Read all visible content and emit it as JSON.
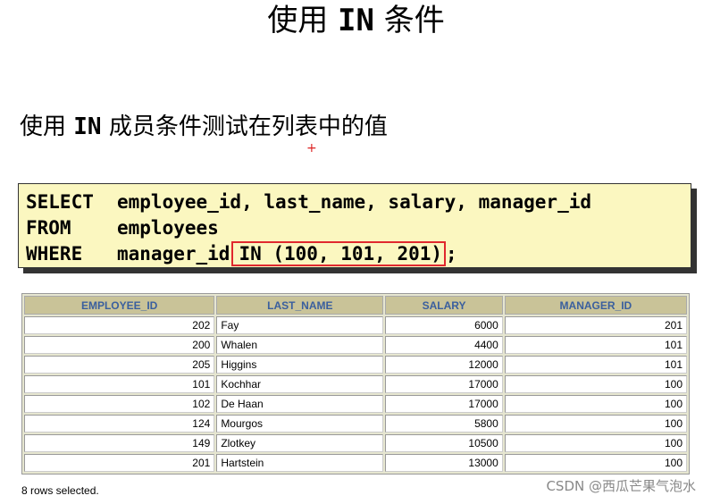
{
  "title": {
    "prefix": "使用",
    "keyword": "IN",
    "suffix": "条件"
  },
  "subtitle": {
    "prefix": "使用",
    "keyword": "IN",
    "suffix": "成员条件测试在列表中的值"
  },
  "sql": {
    "line1_kw": "SELECT",
    "line1_rest": "employee_id, last_name, salary, manager_id",
    "line2_kw": "FROM",
    "line2_rest": "employees",
    "line3_kw": "WHERE",
    "line3_pre": "manager_id",
    "line3_highlight": "IN (100, 101, 201)",
    "line3_post": ";"
  },
  "table": {
    "columns": [
      "EMPLOYEE_ID",
      "LAST_NAME",
      "SALARY",
      "MANAGER_ID"
    ],
    "rows": [
      [
        "202",
        "Fay",
        "6000",
        "201"
      ],
      [
        "200",
        "Whalen",
        "4400",
        "101"
      ],
      [
        "205",
        "Higgins",
        "12000",
        "101"
      ],
      [
        "101",
        "Kochhar",
        "17000",
        "100"
      ],
      [
        "102",
        "De Haan",
        "17000",
        "100"
      ],
      [
        "124",
        "Mourgos",
        "5800",
        "100"
      ],
      [
        "149",
        "Zlotkey",
        "10500",
        "100"
      ],
      [
        "201",
        "Hartstein",
        "13000",
        "100"
      ]
    ]
  },
  "footer": "8 rows selected.",
  "watermark": "CSDN @西瓜芒果气泡水",
  "marker": "+",
  "colors": {
    "highlight_border": "#e0282e",
    "code_background": "#fbf7c0",
    "header_text": "#3a5f9e",
    "header_background": "#c9c398"
  }
}
